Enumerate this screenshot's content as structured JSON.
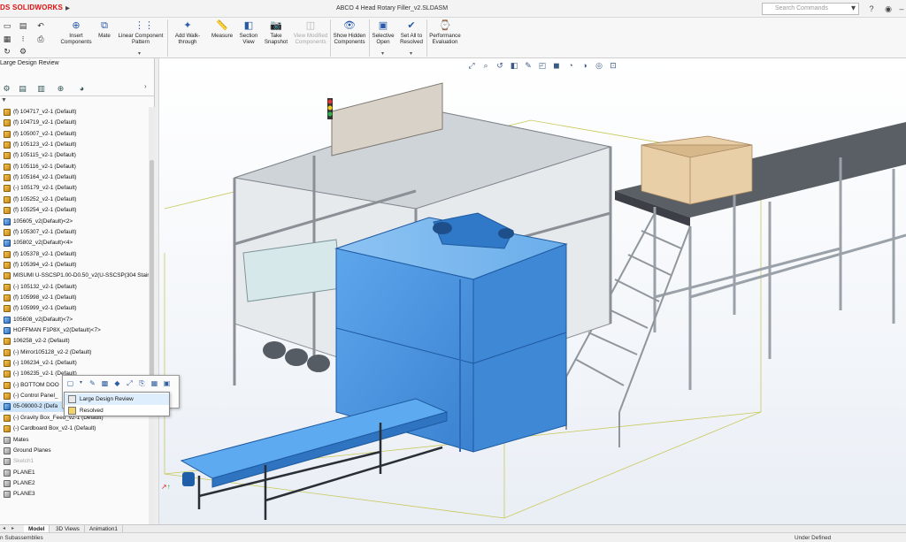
{
  "app": {
    "logo_text": "SOLIDWORKS",
    "document_title": "ABCO 4 Head Rotary Filler_v2.SLDASM",
    "search_placeholder": "Search Commands",
    "window_icons": [
      "search-icon",
      "help-icon",
      "user-icon",
      "minimize-icon"
    ]
  },
  "ribbon": {
    "buttons": [
      {
        "name": "insert-components-button",
        "label": "Insert Components",
        "icon": "insert-components-icon",
        "enabled": true
      },
      {
        "name": "mate-button",
        "label": "Mate",
        "icon": "mate-icon",
        "enabled": true
      },
      {
        "name": "linear-component-pattern-button",
        "label": "Linear Component Pattern",
        "icon": "pattern-icon",
        "enabled": true
      },
      {
        "name": "add-walk-through-button",
        "label": "Add Walk-through",
        "icon": "walk-through-icon",
        "enabled": true
      },
      {
        "name": "measure-button",
        "label": "Measure",
        "icon": "measure-icon",
        "enabled": true
      },
      {
        "name": "section-view-button",
        "label": "Section View",
        "icon": "section-view-icon",
        "enabled": true
      },
      {
        "name": "take-snapshot-button",
        "label": "Take Snapshot",
        "icon": "camera-icon",
        "enabled": true
      },
      {
        "name": "view-modified-components-button",
        "label": "View Modified Components",
        "icon": "modified-components-icon",
        "enabled": false
      },
      {
        "name": "show-hidden-components-button",
        "label": "Show Hidden Components",
        "icon": "show-hidden-icon",
        "enabled": true
      },
      {
        "name": "selective-open-button",
        "label": "Selective Open",
        "icon": "selective-open-icon",
        "enabled": true
      },
      {
        "name": "set-all-to-resolved-button",
        "label": "Set All to Resolved",
        "icon": "resolved-icon",
        "enabled": true
      },
      {
        "name": "performance-evaluation-button",
        "label": "Performance Evaluation",
        "icon": "performance-icon",
        "enabled": true
      }
    ]
  },
  "panel": {
    "title": "Large Design Review",
    "tree": [
      {
        "label": "(f) 104717_v2-1 (Default)",
        "icon": "part"
      },
      {
        "label": "(f) 104719_v2-1 (Default)",
        "icon": "part"
      },
      {
        "label": "(f) 105007_v2-1 (Default)",
        "icon": "part"
      },
      {
        "label": "(f) 105123_v2-1 (Default)",
        "icon": "part"
      },
      {
        "label": "(f) 105115_v2-1 (Default)",
        "icon": "part"
      },
      {
        "label": "(f) 105116_v2-1 (Default)",
        "icon": "part"
      },
      {
        "label": "(f) 105164_v2-1 (Default)",
        "icon": "part"
      },
      {
        "label": "(-) 105179_v2-1 (Default)",
        "icon": "part"
      },
      {
        "label": "(f) 105252_v2-1 (Default)",
        "icon": "part"
      },
      {
        "label": "(f) 105254_v2-1 (Default)",
        "icon": "part"
      },
      {
        "label": "105605_v2(Default)<2>",
        "icon": "assembly"
      },
      {
        "label": "(f) 105307_v2-1 (Default)",
        "icon": "part"
      },
      {
        "label": "105802_v2(Default)<4>",
        "icon": "assembly"
      },
      {
        "label": "(f) 105378_v2-1 (Default)",
        "icon": "part"
      },
      {
        "label": "(f) 105394_v2-1 (Default)",
        "icon": "part"
      },
      {
        "label": "MISUMI U-SSCSP1.00-D0.50_v2(U-SSCSP(304 Stair",
        "icon": "part"
      },
      {
        "label": "(-) 105132_v2-1 (Default)",
        "icon": "part"
      },
      {
        "label": "(f) 105998_v2-1 (Default)",
        "icon": "part"
      },
      {
        "label": "(f) 105999_v2-1 (Default)",
        "icon": "part"
      },
      {
        "label": "105608_v2(Default)<7>",
        "icon": "assembly"
      },
      {
        "label": "HOFFMAN F1P8X_v2(Default)<7>",
        "icon": "assembly"
      },
      {
        "label": "106258_v2-2 (Default)",
        "icon": "part"
      },
      {
        "label": "(-) Mirror105128_v2-2 (Default)",
        "icon": "part"
      },
      {
        "label": "(-) 106234_v2-1 (Default)",
        "icon": "part"
      },
      {
        "label": "(-) 106235_v2-1 (Default)",
        "icon": "part"
      },
      {
        "label": "(-) BOTTOM DOO",
        "icon": "part"
      },
      {
        "label": "(-) Control Panel_",
        "icon": "part"
      },
      {
        "label": "05-09000-2 (Defa",
        "icon": "assembly",
        "selected": true
      },
      {
        "label": "(-) Gravity Box_Feed_v2-1 (Default)",
        "icon": "part"
      },
      {
        "label": "(-) Cardboard Box_v2-1 (Default)",
        "icon": "part"
      },
      {
        "label": "Mates",
        "icon": "mates"
      },
      {
        "label": "Ground Planes",
        "icon": "folder"
      },
      {
        "label": "Sketch1",
        "icon": "sketch",
        "dimmed": true
      },
      {
        "label": "PLANE1",
        "icon": "plane"
      },
      {
        "label": "PLANE2",
        "icon": "plane"
      },
      {
        "label": "PLANE3",
        "icon": "plane"
      }
    ]
  },
  "context_menu": {
    "items": [
      {
        "label": "Large Design Review",
        "highlighted": true
      },
      {
        "label": "Resolved",
        "highlighted": false
      }
    ]
  },
  "bottom_tabs": [
    "Model",
    "3D Views",
    "Animation1"
  ],
  "status": {
    "left": "n Subassemblies",
    "right": "Under Defined"
  },
  "colors": {
    "selected_blue": "#4a96e0",
    "brand_red": "#d11111"
  }
}
